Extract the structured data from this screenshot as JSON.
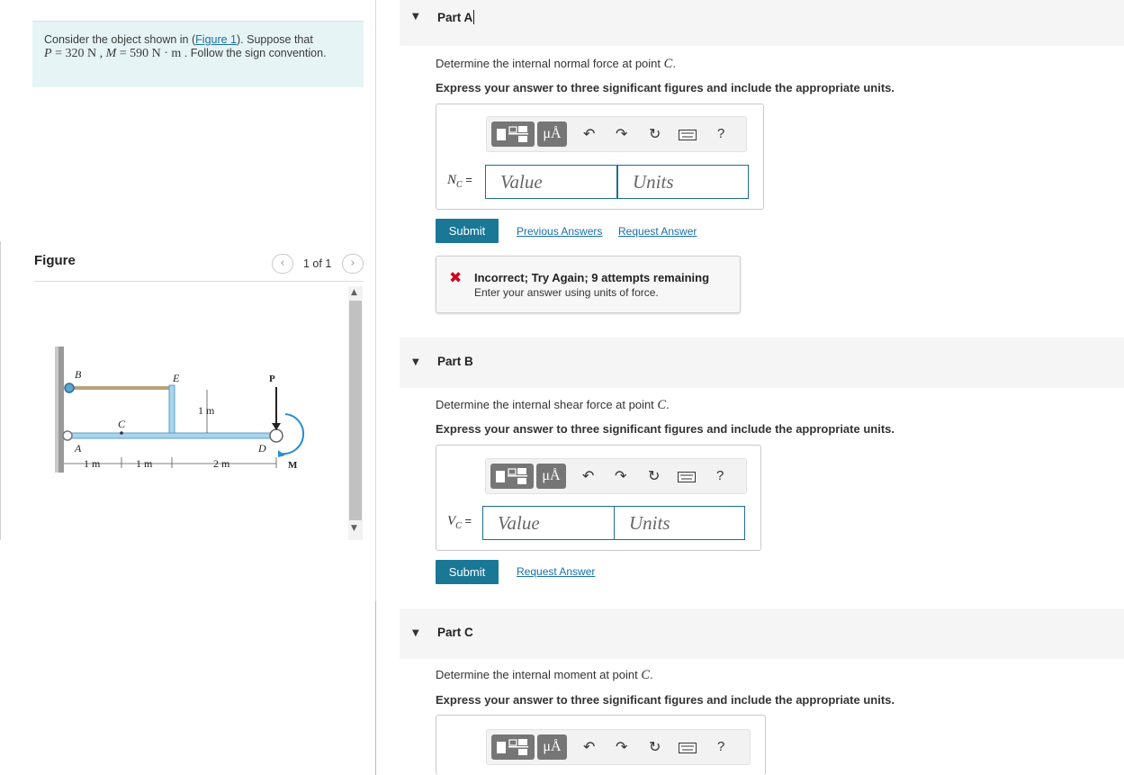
{
  "intro": {
    "text_pre": "Consider the object shown in (",
    "figure_link": "Figure 1",
    "text_post": "). Suppose that",
    "p_label": "P",
    "p_value": " = 320  N , ",
    "m_label": "M",
    "m_value": " = 590  N · m",
    "text_end": " . Follow the sign convention."
  },
  "figure": {
    "title": "Figure",
    "pager": "1 of 1",
    "prev_icon": "chevron-left-icon",
    "next_icon": "chevron-right-icon",
    "labels": {
      "B": "B",
      "E": "E",
      "P": "P",
      "C": "C",
      "A": "A",
      "D": "D",
      "M": "M",
      "dim_1m_vertical": "1 m",
      "dim_1": "1 m",
      "dim_2": "1 m",
      "dim_3": "2 m"
    }
  },
  "toolbar": {
    "mu_label": "μÅ",
    "undo_icon": "undo-icon",
    "redo_icon": "redo-icon",
    "reset_icon": "reset-icon",
    "keyboard_icon": "keyboard-icon",
    "help_label": "?"
  },
  "parts": [
    {
      "title": "Part A",
      "question_pre": "Determine the internal normal force at point ",
      "question_point": "C",
      "question_post": ".",
      "instruction": "Express your answer to three significant figures and include the appropriate units.",
      "var_symbol": "N",
      "var_sub": "C",
      "var_eq": " =",
      "value_placeholder": "Value",
      "units_placeholder": "Units",
      "submit_label": "Submit",
      "link_previous": "Previous Answers",
      "link_request": "Request Answer",
      "feedback_head": "Incorrect; Try Again; 9 attempts remaining",
      "feedback_sub": "Enter your answer using units of force."
    },
    {
      "title": "Part B",
      "question_pre": "Determine the internal shear force at point ",
      "question_point": "C",
      "question_post": ".",
      "instruction": "Express your answer to three significant figures and include the appropriate units.",
      "var_symbol": "V",
      "var_sub": "C",
      "var_eq": " =",
      "value_placeholder": "Value",
      "units_placeholder": "Units",
      "submit_label": "Submit",
      "link_request": "Request Answer"
    },
    {
      "title": "Part C",
      "question_pre": "Determine the internal moment at point ",
      "question_point": "C",
      "question_post": ".",
      "instruction": "Express your answer to three significant figures and include the appropriate units."
    }
  ],
  "colors": {
    "accent": "#1a7896",
    "intro_bg": "#e6f4f6",
    "error": "#d0021b"
  }
}
